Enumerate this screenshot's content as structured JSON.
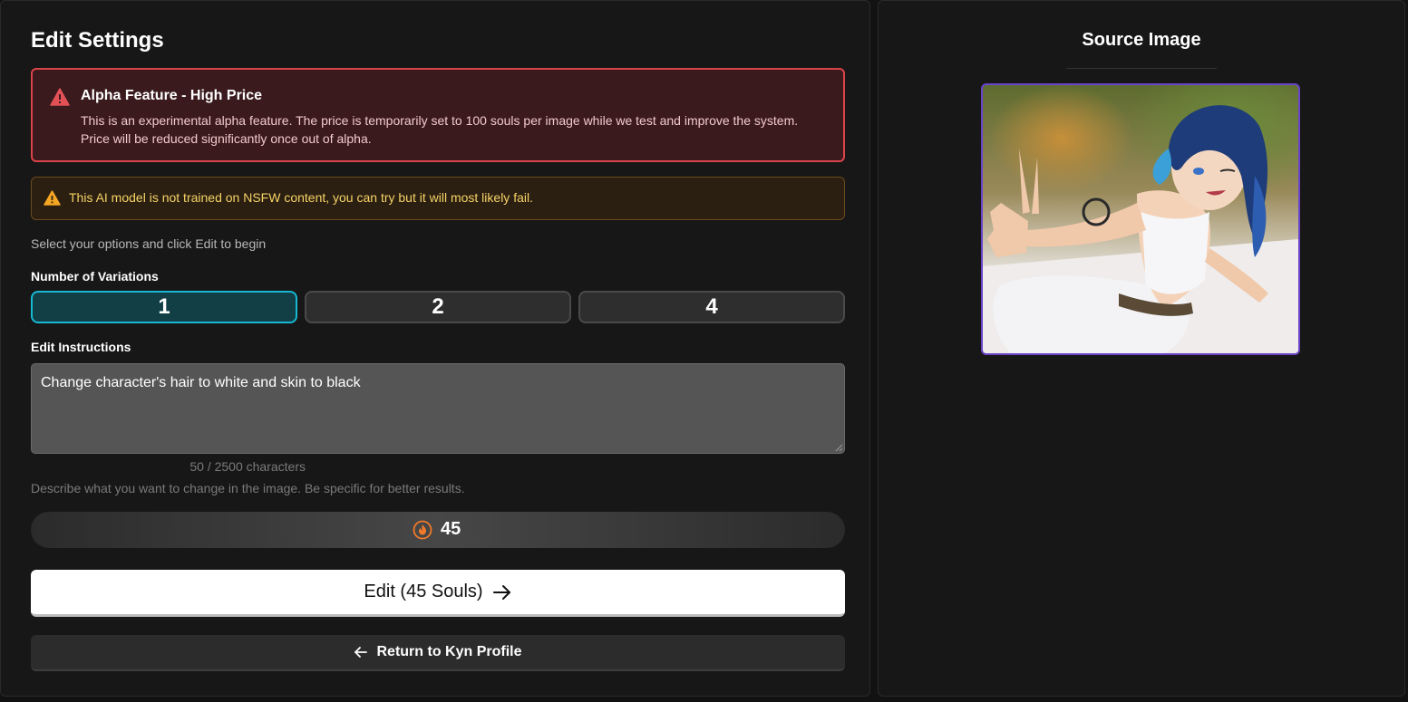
{
  "left_panel": {
    "title": "Edit Settings",
    "alert_alpha": {
      "title": "Alpha Feature - High Price",
      "body": "This is an experimental alpha feature. The price is temporarily set to 100 souls per image while we test and improve the system. Price will be reduced significantly once out of alpha."
    },
    "alert_nsfw": {
      "text": "This AI model is not trained on NSFW content, you can try but it will most likely fail."
    },
    "intro": "Select your options and click Edit to begin",
    "variations": {
      "label": "Number of Variations",
      "options": [
        "1",
        "2",
        "4"
      ],
      "selected": "1"
    },
    "instructions": {
      "label": "Edit Instructions",
      "value": "Change character's hair to white and skin to black",
      "char_count": "50 / 2500 characters",
      "hint": "Describe what you want to change in the image. Be specific for better results."
    },
    "cost": {
      "value": "45"
    },
    "edit_button": "Edit (45 Souls)",
    "return_button": "Return to Kyn Profile"
  },
  "right_panel": {
    "title": "Source Image"
  },
  "colors": {
    "accent_selected": "#16b8d3",
    "alert_red": "#d9444a",
    "alert_amber": "#f6d365",
    "flame": "#f07a2a",
    "image_border": "#6a44c9"
  },
  "icons": {
    "alpha_alert": "warning-triangle-icon",
    "nsfw_alert": "warning-triangle-icon",
    "cost": "flame-icon",
    "edit": "arrow-right-icon",
    "return": "arrow-left-icon"
  }
}
